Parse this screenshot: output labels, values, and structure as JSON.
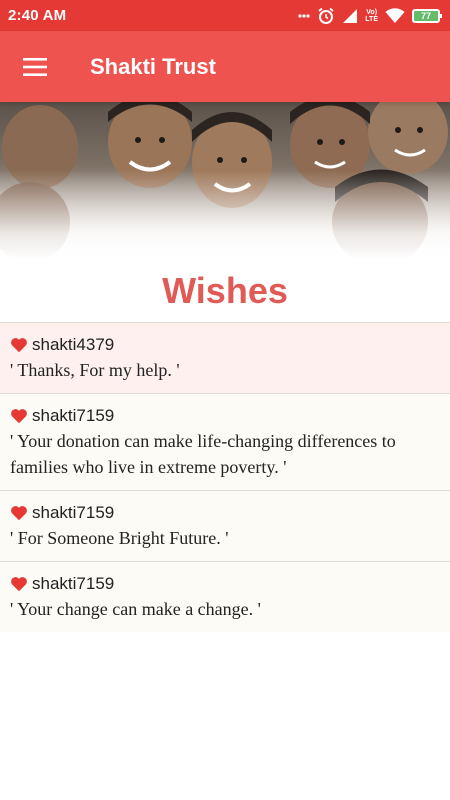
{
  "status_bar": {
    "time": "2:40 AM",
    "icons": [
      "more-dots-icon",
      "alarm-icon",
      "signal-icon",
      "volte-icon",
      "wifi-icon",
      "battery-icon"
    ],
    "volte_label": "Vo)\nLTE",
    "battery_level": "77"
  },
  "app_bar": {
    "title": "Shakti Trust",
    "menu_icon": "hamburger-menu-icon"
  },
  "section": {
    "title": "Wishes"
  },
  "wishes": [
    {
      "user": "shakti4379",
      "message": "' Thanks, For my help. '"
    },
    {
      "user": "shakti7159",
      "message": "' Your donation can make life-changing differences to families who live in extreme poverty. '"
    },
    {
      "user": "shakti7159",
      "message": "' For Someone Bright Future. '"
    },
    {
      "user": "shakti7159",
      "message": "' Your change can make a change. '"
    }
  ],
  "colors": {
    "status_bar": "#e53935",
    "app_bar": "#ef5350",
    "title_accent": "#e05a56",
    "heart": "#e53935",
    "first_item_bg": "#fdf0ef",
    "item_bg": "#fcfbf6"
  }
}
